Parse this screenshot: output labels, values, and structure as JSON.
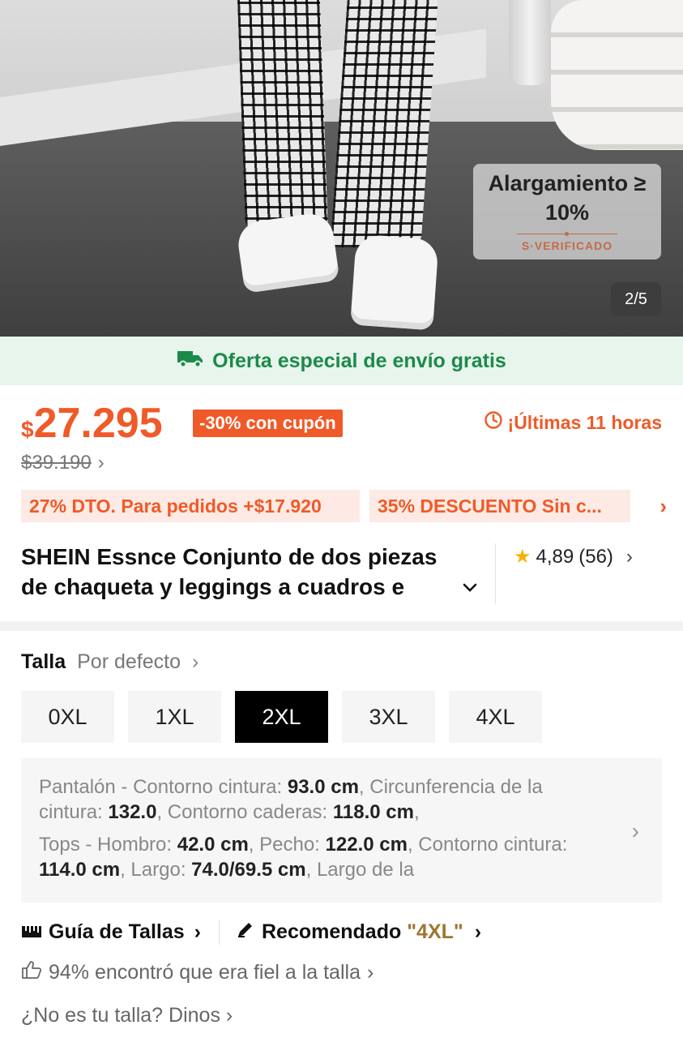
{
  "gallery": {
    "badge_line1": "Alargamiento ≥",
    "badge_line2": "10%",
    "badge_sub": "S·VERIFICADO",
    "counter": "2/5"
  },
  "shipping": {
    "text": "Oferta especial de envío gratis",
    "color": "#1c8a4a"
  },
  "price": {
    "currency": "$",
    "value": "27.295",
    "coupon": "-30% con cupón",
    "timer": "¡Últimas 11 horas",
    "original": "$39.190",
    "accent_color": "#f05a28"
  },
  "promos": [
    "27% DTO. Para pedidos +$17.920",
    "35% DESCUENTO Sin c..."
  ],
  "product": {
    "title_line1": "SHEIN Essnce Conjunto de dos piezas",
    "title_line2": "de chaqueta y leggings a cuadros e",
    "rating": "4,89",
    "reviews": "(56)"
  },
  "size": {
    "label": "Talla",
    "default": "Por defecto",
    "options": [
      "0XL",
      "1XL",
      "2XL",
      "3XL",
      "4XL"
    ],
    "selected": "2XL"
  },
  "measurements": {
    "a1": "Pantalón - Contorno cintura: ",
    "v1": "93.0 cm",
    "a2": ", Circunferencia de la cintura: ",
    "v2": "132.0",
    "a3": ", Contorno caderas: ",
    "v3": "118.0 cm",
    "a4": ",",
    "b1": "Tops - Hombro: ",
    "w1": "42.0 cm",
    "b2": ", Pecho: ",
    "w2": "122.0 cm",
    "b3": ", Contorno cintura: ",
    "w3": "114.0 cm",
    "b4": ", Largo: ",
    "w4": "74.0/69.5 cm",
    "b5": ", Largo de la"
  },
  "guide": {
    "size_guide": "Guía de Tallas",
    "recommended_label": "Recomendado ",
    "recommended_value": "\"4XL\"",
    "fit": "94% encontró que era fiel a la talla",
    "ask": "¿No es tu talla? Dinos"
  }
}
